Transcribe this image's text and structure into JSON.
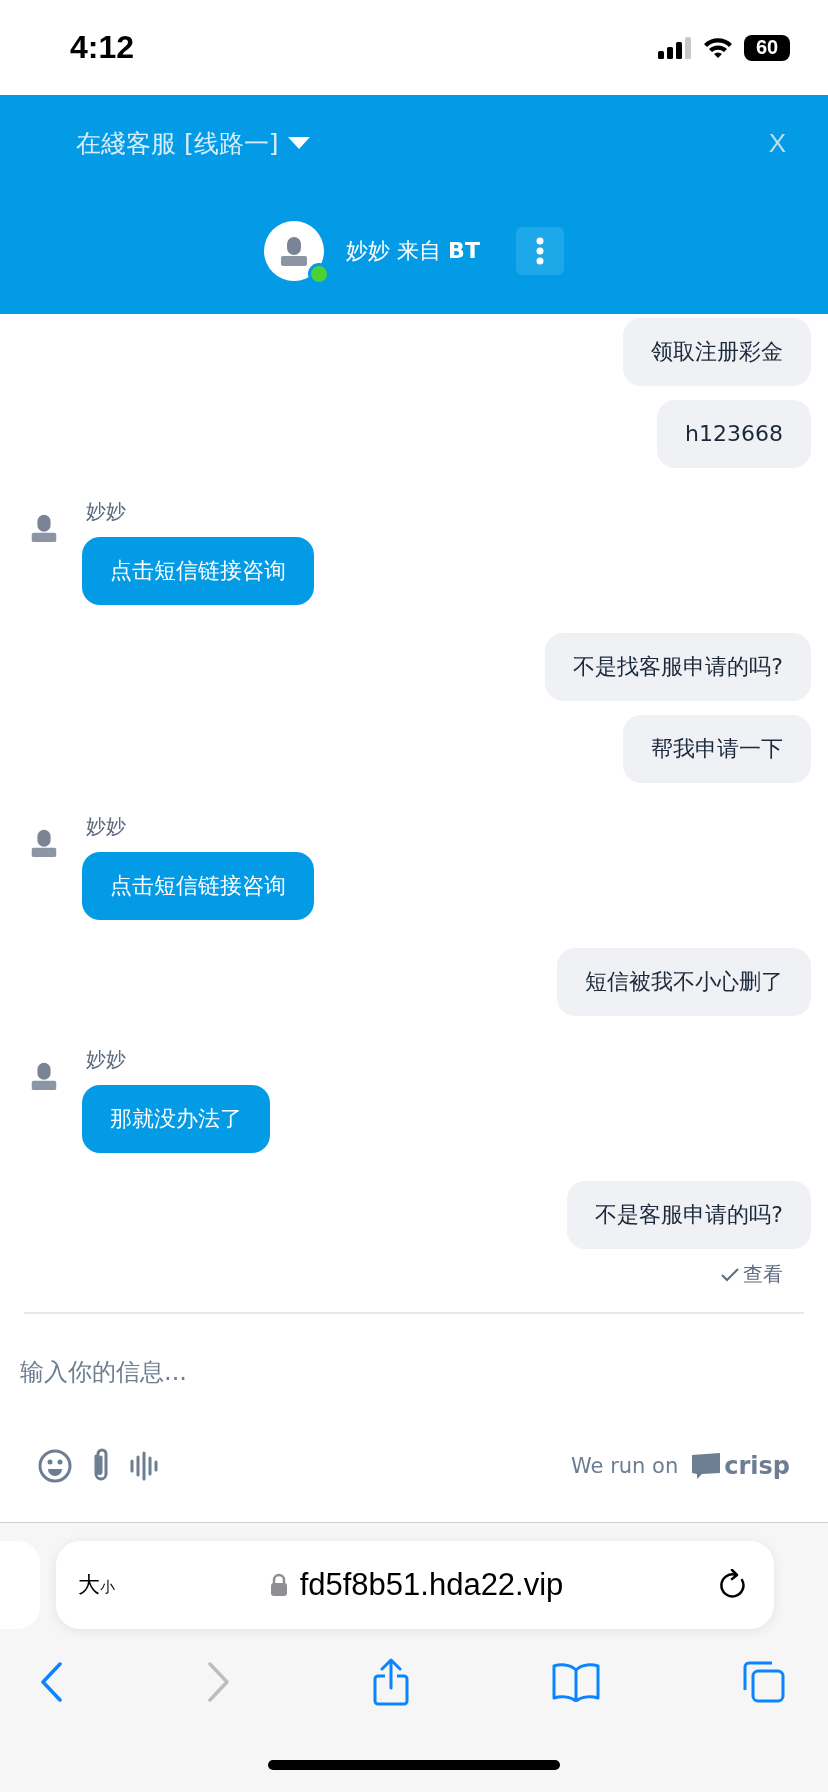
{
  "status_bar": {
    "time": "4:12",
    "battery": "60"
  },
  "header": {
    "title": "在綫客服 [线路一]",
    "close": "X",
    "agent": {
      "name": "妙妙 来自 **BT**",
      "online": true
    }
  },
  "messages": [
    {
      "kind": "user",
      "text": "领取注册彩金"
    },
    {
      "kind": "user",
      "text": "h123668"
    },
    {
      "kind": "agent",
      "author": "妙妙",
      "text": "点击短信链接咨询"
    },
    {
      "kind": "user",
      "text": "不是找客服申请的吗?"
    },
    {
      "kind": "user",
      "text": "帮我申请一下"
    },
    {
      "kind": "agent",
      "author": "妙妙",
      "text": "点击短信链接咨询"
    },
    {
      "kind": "user",
      "text": "短信被我不小心删了"
    },
    {
      "kind": "agent",
      "author": "妙妙",
      "text": "那就没办法了"
    },
    {
      "kind": "user",
      "text": "不是客服申请的吗?"
    }
  ],
  "read_receipt": "查看",
  "composer": {
    "placeholder": "输入你的信息...",
    "branding": "We run on",
    "brand": "crisp"
  },
  "browser": {
    "text_size": {
      "large": "大",
      "small": "小"
    },
    "url": "fd5f8b51.hda22.vip"
  }
}
